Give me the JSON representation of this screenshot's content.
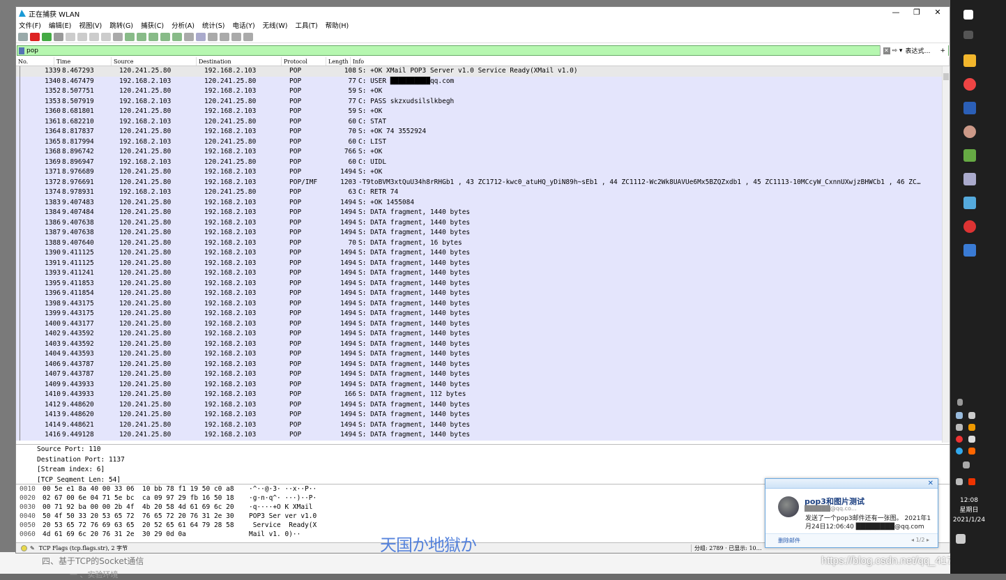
{
  "window": {
    "title": "正在捕获 WLAN",
    "controls": [
      "—",
      "❐",
      "✕"
    ]
  },
  "menu": [
    "文件(F)",
    "编辑(E)",
    "视图(V)",
    "跳转(G)",
    "捕获(C)",
    "分析(A)",
    "统计(S)",
    "电话(Y)",
    "无线(W)",
    "工具(T)",
    "帮助(H)"
  ],
  "filter": {
    "value": "pop",
    "expression_label": "表达式…",
    "plus": "+"
  },
  "columns": [
    "No.",
    "Time",
    "Source",
    "Destination",
    "Protocol",
    "Length",
    "Info"
  ],
  "packets": [
    [
      "1339",
      "8.467293",
      "120.241.25.80",
      "192.168.2.103",
      "POP",
      "108",
      "S: +OK XMail POP3 Server v1.0 Service Ready(XMail v1.0)"
    ],
    [
      "1340",
      "8.467479",
      "192.168.2.103",
      "120.241.25.80",
      "POP",
      "77",
      "C: USER ██████████qq.com"
    ],
    [
      "1352",
      "8.507751",
      "120.241.25.80",
      "192.168.2.103",
      "POP",
      "59",
      "S: +OK"
    ],
    [
      "1353",
      "8.507919",
      "192.168.2.103",
      "120.241.25.80",
      "POP",
      "77",
      "C: PASS skzxudsilslkbegh"
    ],
    [
      "1360",
      "8.681801",
      "120.241.25.80",
      "192.168.2.103",
      "POP",
      "59",
      "S: +OK"
    ],
    [
      "1361",
      "8.682210",
      "192.168.2.103",
      "120.241.25.80",
      "POP",
      "60",
      "C: STAT"
    ],
    [
      "1364",
      "8.817837",
      "120.241.25.80",
      "192.168.2.103",
      "POP",
      "70",
      "S: +OK 74 3552924"
    ],
    [
      "1365",
      "8.817994",
      "192.168.2.103",
      "120.241.25.80",
      "POP",
      "60",
      "C: LIST"
    ],
    [
      "1368",
      "8.896742",
      "120.241.25.80",
      "192.168.2.103",
      "POP",
      "766",
      "S: +OK"
    ],
    [
      "1369",
      "8.896947",
      "192.168.2.103",
      "120.241.25.80",
      "POP",
      "60",
      "C: UIDL"
    ],
    [
      "1371",
      "8.976689",
      "120.241.25.80",
      "192.168.2.103",
      "POP",
      "1494",
      "S: +OK"
    ],
    [
      "1372",
      "8.976691",
      "120.241.25.80",
      "192.168.2.103",
      "POP/IMF",
      "1203",
      "-T9toBVM3xtQuU34h8rRHGb1  , 43 ZC1712-kwc0_atuHQ_yDiN89h~sEb1  , 44 ZC1112-Wc2Wk8UAVUe6Mx5BZQZxdb1  , 45 ZC1113-10MCcyW_CxnnUXwjzBHWCb1  , 46 ZC…"
    ],
    [
      "1374",
      "8.978931",
      "192.168.2.103",
      "120.241.25.80",
      "POP",
      "63",
      "C: RETR 74"
    ],
    [
      "1383",
      "9.407483",
      "120.241.25.80",
      "192.168.2.103",
      "POP",
      "1494",
      "S: +OK 1455084"
    ],
    [
      "1384",
      "9.407484",
      "120.241.25.80",
      "192.168.2.103",
      "POP",
      "1494",
      "S: DATA fragment, 1440 bytes"
    ],
    [
      "1386",
      "9.407638",
      "120.241.25.80",
      "192.168.2.103",
      "POP",
      "1494",
      "S: DATA fragment, 1440 bytes"
    ],
    [
      "1387",
      "9.407638",
      "120.241.25.80",
      "192.168.2.103",
      "POP",
      "1494",
      "S: DATA fragment, 1440 bytes"
    ],
    [
      "1388",
      "9.407640",
      "120.241.25.80",
      "192.168.2.103",
      "POP",
      "70",
      "S: DATA fragment, 16 bytes"
    ],
    [
      "1390",
      "9.411125",
      "120.241.25.80",
      "192.168.2.103",
      "POP",
      "1494",
      "S: DATA fragment, 1440 bytes"
    ],
    [
      "1391",
      "9.411125",
      "120.241.25.80",
      "192.168.2.103",
      "POP",
      "1494",
      "S: DATA fragment, 1440 bytes"
    ],
    [
      "1393",
      "9.411241",
      "120.241.25.80",
      "192.168.2.103",
      "POP",
      "1494",
      "S: DATA fragment, 1440 bytes"
    ],
    [
      "1395",
      "9.411853",
      "120.241.25.80",
      "192.168.2.103",
      "POP",
      "1494",
      "S: DATA fragment, 1440 bytes"
    ],
    [
      "1396",
      "9.411854",
      "120.241.25.80",
      "192.168.2.103",
      "POP",
      "1494",
      "S: DATA fragment, 1440 bytes"
    ],
    [
      "1398",
      "9.443175",
      "120.241.25.80",
      "192.168.2.103",
      "POP",
      "1494",
      "S: DATA fragment, 1440 bytes"
    ],
    [
      "1399",
      "9.443175",
      "120.241.25.80",
      "192.168.2.103",
      "POP",
      "1494",
      "S: DATA fragment, 1440 bytes"
    ],
    [
      "1400",
      "9.443177",
      "120.241.25.80",
      "192.168.2.103",
      "POP",
      "1494",
      "S: DATA fragment, 1440 bytes"
    ],
    [
      "1402",
      "9.443592",
      "120.241.25.80",
      "192.168.2.103",
      "POP",
      "1494",
      "S: DATA fragment, 1440 bytes"
    ],
    [
      "1403",
      "9.443592",
      "120.241.25.80",
      "192.168.2.103",
      "POP",
      "1494",
      "S: DATA fragment, 1440 bytes"
    ],
    [
      "1404",
      "9.443593",
      "120.241.25.80",
      "192.168.2.103",
      "POP",
      "1494",
      "S: DATA fragment, 1440 bytes"
    ],
    [
      "1406",
      "9.443787",
      "120.241.25.80",
      "192.168.2.103",
      "POP",
      "1494",
      "S: DATA fragment, 1440 bytes"
    ],
    [
      "1407",
      "9.443787",
      "120.241.25.80",
      "192.168.2.103",
      "POP",
      "1494",
      "S: DATA fragment, 1440 bytes"
    ],
    [
      "1409",
      "9.443933",
      "120.241.25.80",
      "192.168.2.103",
      "POP",
      "1494",
      "S: DATA fragment, 1440 bytes"
    ],
    [
      "1410",
      "9.443933",
      "120.241.25.80",
      "192.168.2.103",
      "POP",
      "166",
      "S: DATA fragment, 112 bytes"
    ],
    [
      "1412",
      "9.448620",
      "120.241.25.80",
      "192.168.2.103",
      "POP",
      "1494",
      "S: DATA fragment, 1440 bytes"
    ],
    [
      "1413",
      "9.448620",
      "120.241.25.80",
      "192.168.2.103",
      "POP",
      "1494",
      "S: DATA fragment, 1440 bytes"
    ],
    [
      "1414",
      "9.448621",
      "120.241.25.80",
      "192.168.2.103",
      "POP",
      "1494",
      "S: DATA fragment, 1440 bytes"
    ],
    [
      "1416",
      "9.449128",
      "120.241.25.80",
      "192.168.2.103",
      "POP",
      "1494",
      "S: DATA fragment, 1440 bytes"
    ]
  ],
  "details": [
    "Source Port: 110",
    "Destination Port: 1137",
    "[Stream index: 6]",
    "[TCP Segment Len: 54]"
  ],
  "hex": [
    {
      "off": "0010",
      "bytes": "00 5e e1 8a 40 00 33 06  10 bb 78 f1 19 50 c0 a8",
      "ascii": "·^··@·3· ··x··P··"
    },
    {
      "off": "0020",
      "bytes": "02 67 00 6e 04 71 5e bc  ca 09 97 29 fb 16 50 18",
      "ascii": "·g·n·q^· ···)··P·"
    },
    {
      "off": "0030",
      "bytes": "00 71 92 ba 00 00 2b 4f  4b 20 58 4d 61 69 6c 20",
      "ascii": "·q····+O K XMail "
    },
    {
      "off": "0040",
      "bytes": "50 4f 50 33 20 53 65 72  76 65 72 20 76 31 2e 30",
      "ascii": "POP3 Ser ver v1.0"
    },
    {
      "off": "0050",
      "bytes": "20 53 65 72 76 69 63 65  20 52 65 61 64 79 28 58",
      "ascii": " Service  Ready(X"
    },
    {
      "off": "0060",
      "bytes": "4d 61 69 6c 20 76 31 2e  30 29 0d 0a",
      "ascii": "Mail v1. 0)··"
    }
  ],
  "status": {
    "left": "TCP Flags (tcp.flags.str), 2 字节",
    "right": "分组: 2789 · 已显示: 10…"
  },
  "notification": {
    "title": "pop3和图片测试",
    "from": "██████@qq.co…",
    "body": "发送了一个pop3邮件还有一张图。 2021年1月24日12:06:40 ████████@qq.com",
    "delete": "删除邮件",
    "page": "1/2",
    "close": "✕"
  },
  "overlay_text": "天国か地獄か",
  "watermark": "https://blog.csdn.net/qq_41731201",
  "desk_text": [
    "四、基于TCP的Socket通信",
    "一 、实验环境"
  ],
  "clock": {
    "time": "12:08",
    "day": "星期日",
    "date": "2021/1/24"
  },
  "colors": {
    "row_bg": "#e4e5fc",
    "filter_bg": "#b6f7b0",
    "highlight": "#2a73d4"
  }
}
